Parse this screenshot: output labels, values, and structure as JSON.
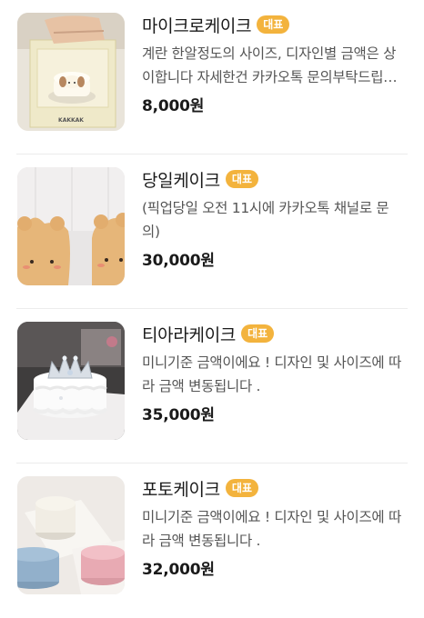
{
  "menu": {
    "items": [
      {
        "title": "마이크로케이크",
        "badge": "대표",
        "description": "계란 한알정도의 사이즈, 디자인별 금액은 상이합니다 자세한건 카카오톡 문의부탁드립니다",
        "price": "8,000원",
        "image": "micro-cake-box-photo"
      },
      {
        "title": "당일케이크",
        "badge": "대표",
        "description": "(픽업당일 오전 11시에 카카오톡 채널로 문의)",
        "price": "30,000원",
        "image": "bear-cakes-photo"
      },
      {
        "title": "티아라케이크",
        "badge": "대표",
        "description": "미니기준 금액이에요 ! 디자인 및 사이즈에 따라 금액 변동됩니다 .",
        "price": "35,000원",
        "image": "tiara-cake-photo"
      },
      {
        "title": "포토케이크",
        "badge": "대표",
        "description": "미니기준 금액이에요 ! 디자인 및 사이즈에 따라 금액 변동됩니다 .",
        "price": "32,000원",
        "image": "photo-cakes-photo"
      }
    ]
  },
  "box_label": "KAKKAK"
}
